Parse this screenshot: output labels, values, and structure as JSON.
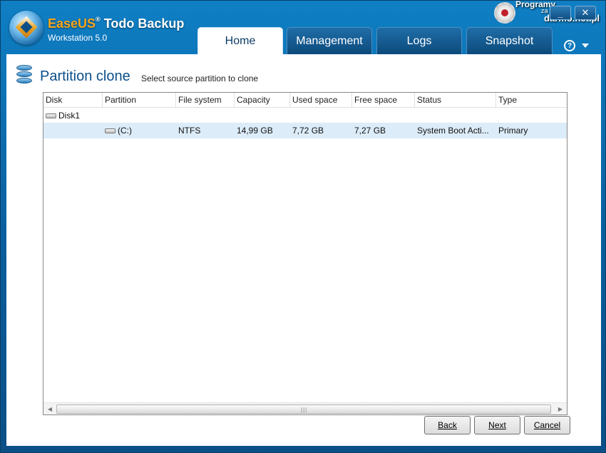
{
  "app": {
    "brand_name": "EaseUS",
    "product_name": "Todo Backup",
    "registered_mark": "®",
    "edition": "Workstation 5.0"
  },
  "tabs": [
    {
      "label": "Home",
      "active": true
    },
    {
      "label": "Management",
      "active": false
    },
    {
      "label": "Logs",
      "active": false
    },
    {
      "label": "Snapshot",
      "active": false
    }
  ],
  "window_controls": {
    "minimize": "_",
    "close": "✕",
    "help": "?"
  },
  "watermark": {
    "line1": "Programy",
    "line2": "za",
    "line3": "darmo.net.pl"
  },
  "page": {
    "title": "Partition clone",
    "subtitle": "Select source partition to clone",
    "icon": "disk-stack-icon"
  },
  "table": {
    "columns": [
      "Disk",
      "Partition",
      "File system",
      "Capacity",
      "Used space",
      "Free space",
      "Status",
      "Type"
    ],
    "disk_row": {
      "disk": "Disk1"
    },
    "partition_row": {
      "partition": "(C:)",
      "file_system": "NTFS",
      "capacity": "14,99 GB",
      "used_space": "7,72 GB",
      "free_space": "7,27 GB",
      "status": "System Boot Acti...",
      "type": "Primary",
      "selected": true
    },
    "scroll_grip": "|||"
  },
  "buttons": {
    "back": "Back",
    "next": "Next",
    "cancel": "Cancel"
  },
  "colors": {
    "frame": "#0a5d9c",
    "accent_title": "#0b4f8a",
    "selected_row": "#dcecf9",
    "brand_orange": "#f7a51c"
  }
}
